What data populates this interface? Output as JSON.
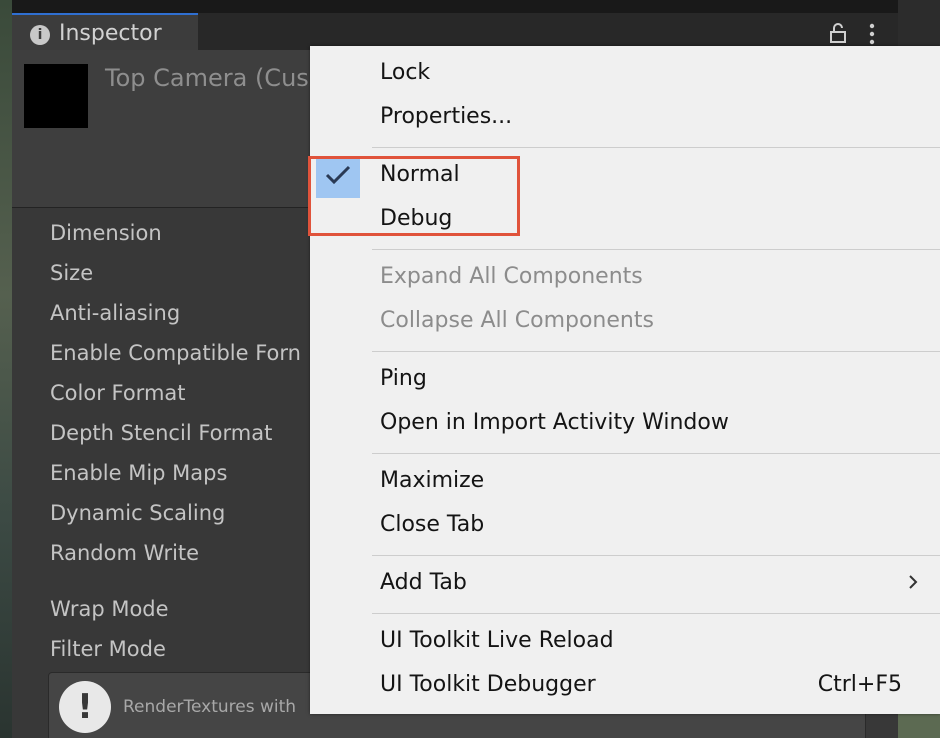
{
  "window": {
    "tab_title": "Inspector",
    "tab_icon": "info-icon",
    "lock_icon": "lock-icon",
    "menu_icon": "kebab-menu-icon"
  },
  "inspector": {
    "object_name": "Top Camera (Cus",
    "properties": [
      "Dimension",
      "Size",
      "Anti-aliasing",
      "Enable Compatible Forn",
      "Color Format",
      "Depth Stencil Format",
      "Enable Mip Maps",
      "Dynamic Scaling",
      "Random Write",
      "Wrap Mode",
      "Filter Mode"
    ],
    "help_text": "RenderTextures with"
  },
  "context_menu": {
    "lock": "Lock",
    "properties": "Properties...",
    "normal": "Normal",
    "debug": "Debug",
    "expand_all": "Expand All Components",
    "collapse_all": "Collapse All Components",
    "ping": "Ping",
    "open_import": "Open in Import Activity Window",
    "maximize": "Maximize",
    "close_tab": "Close Tab",
    "add_tab": "Add Tab",
    "uitk_live_reload": "UI Toolkit Live Reload",
    "uitk_debugger": "UI Toolkit Debugger",
    "uitk_debugger_shortcut": "Ctrl+F5",
    "selected_mode": "Normal"
  },
  "colors": {
    "menu_bg": "#f0f0f0",
    "check_highlight": "#9fc6f2",
    "annotation": "#e0533b",
    "inspector_bg": "#383838"
  }
}
